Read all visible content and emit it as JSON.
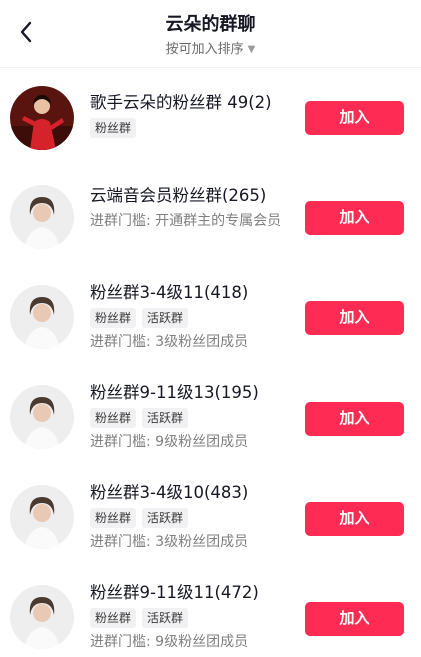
{
  "header": {
    "title": "云朵的群聊",
    "sort_label": "按可加入排序"
  },
  "groups": [
    {
      "name": "歌手云朵的粉丝群 49(2)",
      "tags": [
        "粉丝群"
      ],
      "requirement": "",
      "join_label": "加入"
    },
    {
      "name": "云端音会员粉丝群(265)",
      "tags": [],
      "requirement": "进群门槛: 开通群主的专属会员",
      "join_label": "加入"
    },
    {
      "name": "粉丝群3-4级11(418)",
      "tags": [
        "粉丝群",
        "活跃群"
      ],
      "requirement": "进群门槛: 3级粉丝团成员",
      "join_label": "加入"
    },
    {
      "name": "粉丝群9-11级13(195)",
      "tags": [
        "粉丝群",
        "活跃群"
      ],
      "requirement": "进群门槛: 9级粉丝团成员",
      "join_label": "加入"
    },
    {
      "name": "粉丝群3-4级10(483)",
      "tags": [
        "粉丝群",
        "活跃群"
      ],
      "requirement": "进群门槛: 3级粉丝团成员",
      "join_label": "加入"
    },
    {
      "name": "粉丝群9-11级11(472)",
      "tags": [
        "粉丝群",
        "活跃群"
      ],
      "requirement": "进群门槛: 9级粉丝团成员",
      "join_label": "加入"
    }
  ],
  "colors": {
    "accent": "#fe2c55",
    "tag_bg": "#f1f1f3",
    "muted_text": "#808080"
  },
  "icons": {
    "back": "chevron-left-icon",
    "sort": "caret-down-icon"
  }
}
